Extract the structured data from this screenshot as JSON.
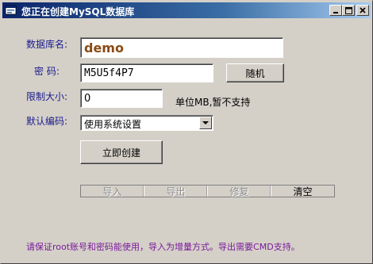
{
  "window": {
    "title": "您正在创建MySQL数据库",
    "title_icon": "mysql-app-icon",
    "controls": {
      "minimize_icon": "minimize-icon",
      "maximize_icon": "maximize-icon",
      "close_icon": "close-icon"
    }
  },
  "form": {
    "db_name_label": "数据库名:",
    "db_name_value": "demo",
    "password_label": "密  码:",
    "password_value": "M5U5f4P7",
    "random_button": "随机",
    "limit_label": "限制大小:",
    "limit_value": "0",
    "limit_note": "单位MB,暂不支持",
    "encoding_label": "默认编码:",
    "encoding_value": "使用系统设置",
    "create_button": "立即创建"
  },
  "toolbar": {
    "items": [
      {
        "label": "导入",
        "enabled": false
      },
      {
        "label": "导出",
        "enabled": false
      },
      {
        "label": "修复",
        "enabled": false
      },
      {
        "label": "清空",
        "enabled": true
      }
    ]
  },
  "footer": {
    "note": "请保证root账号和密码能使用，导入为增量方式。导出需要CMD支持。"
  },
  "colors": {
    "label": "#1a1a8c",
    "db_name_text": "#8a4a14",
    "footer_note": "#7a1a9a",
    "title_bar_start": "#0a246a",
    "title_bar_end": "#a6caf0"
  }
}
